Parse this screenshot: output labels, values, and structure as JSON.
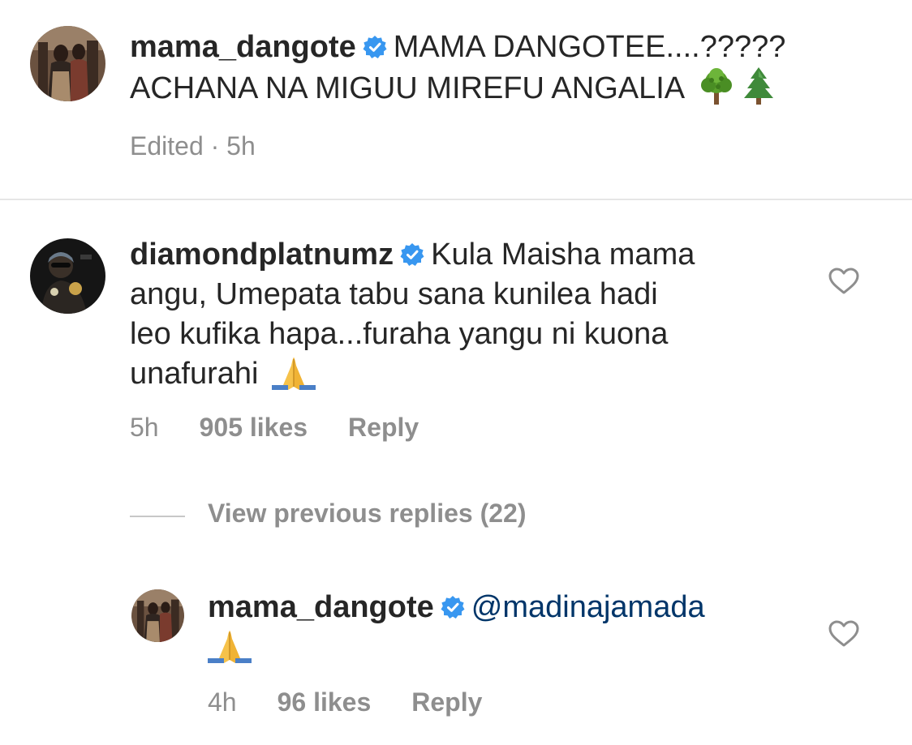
{
  "caption": {
    "username": "mama_dangote",
    "text_line1": "MAMA DANGOTEE....?????",
    "text_line2": "ACHANA NA MIGUU MIREFU ANGALIA",
    "emoji": [
      "deciduous-tree",
      "evergreen-tree"
    ],
    "meta": "Edited · 5h"
  },
  "comments": [
    {
      "username": "diamondplatnumz",
      "text_line1": "Kula Maisha mama",
      "text_line2": "angu,  Umepata tabu sana kunilea hadi",
      "text_line3": "leo kufika hapa...furaha yangu ni kuona",
      "text_line4": "unafurahi",
      "emoji": "folded-hands",
      "time": "5h",
      "likes": "905 likes",
      "reply_label": "Reply"
    }
  ],
  "view_replies": "View previous replies (22)",
  "reply": {
    "username": "mama_dangote",
    "mention": "@madinajamada",
    "emoji": "folded-hands",
    "time": "4h",
    "likes": "96 likes",
    "reply_label": "Reply"
  },
  "colors": {
    "text": "#262626",
    "secondary": "#8e8e8e",
    "verified": "#3897f0",
    "mention": "#003569",
    "divider": "#e6e6e6"
  }
}
